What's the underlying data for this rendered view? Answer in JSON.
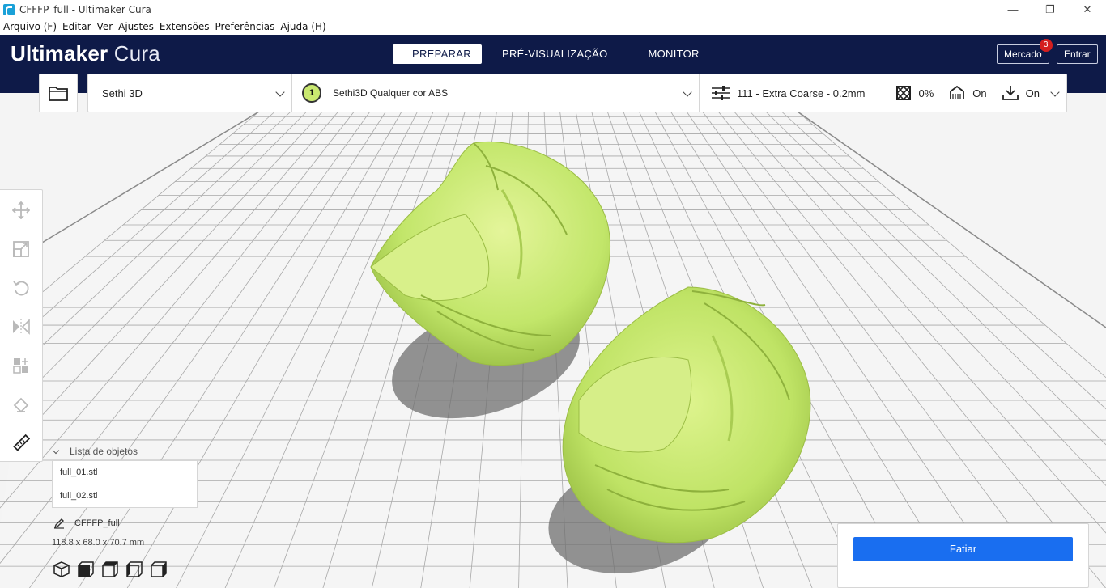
{
  "window": {
    "title": "CFFFP_full - Ultimaker Cura",
    "minimize": "—",
    "restore": "❐",
    "close": "✕"
  },
  "menu": [
    "Arquivo (F)",
    "Editar",
    "Ver",
    "Ajustes",
    "Extensões",
    "Preferências",
    "Ajuda (H)"
  ],
  "header": {
    "logo_bold": "Ultimaker",
    "logo_light": "Cura",
    "tabs": [
      "PREPARAR",
      "PRÉ-VISUALIZAÇÃO",
      "MONITOR"
    ],
    "active_tab": "PREPARAR",
    "marketplace_label": "Mercado",
    "marketplace_badge": "3",
    "signin_label": "Entrar",
    "bg_color": "#0e1a48"
  },
  "printer_bar": {
    "printer": "Sethi 3D",
    "extruder_number": "1",
    "material": "Sethi3D Qualquer cor ABS",
    "profile": "111 - Extra Coarse - 0.2mm",
    "infill": "0%",
    "support": "On",
    "adhesion": "On"
  },
  "object_list": {
    "heading": "Lista de objetos",
    "items": [
      "full_01.stl",
      "full_02.stl"
    ],
    "job_name": "CFFFP_full",
    "dimensions": "118.8 x 68.0 x 70.7 mm"
  },
  "slice": {
    "button_label": "Fatiar",
    "color": "#196ef0"
  },
  "colors": {
    "model": "#c2e66a",
    "grid_line": "#a9a9a9",
    "plate": "#f2f2f2"
  }
}
